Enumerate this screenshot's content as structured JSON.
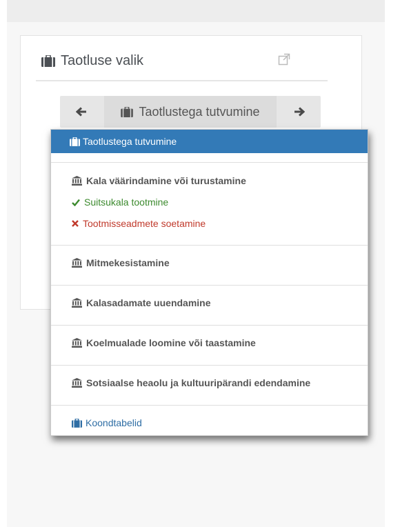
{
  "panel": {
    "title": "Taotluse valik",
    "title_icon": "briefcase-icon",
    "external_icon": "external-link-icon"
  },
  "navigator": {
    "prev_icon": "arrow-left-icon",
    "next_icon": "arrow-right-icon",
    "current_label": "Taotlustega tutvumine",
    "current_icon": "briefcase-icon"
  },
  "dropdown": {
    "active_item": {
      "label": "Taotlustega tutvumine",
      "icon": "briefcase-icon"
    },
    "groups": [
      {
        "label": "Kala väärindamine või turustamine",
        "icon": "institution-icon",
        "subitems": [
          {
            "label": "Suitsukala tootmine",
            "status": "ok",
            "icon": "check-icon"
          },
          {
            "label": "Tootmisseadmete soetamine",
            "status": "error",
            "icon": "times-icon"
          }
        ]
      },
      {
        "label": "Mitmekesistamine",
        "icon": "institution-icon"
      },
      {
        "label": "Kalasadamate uuendamine",
        "icon": "institution-icon"
      },
      {
        "label": "Koelmualade loomine või taastamine",
        "icon": "institution-icon"
      },
      {
        "label": "Sotsiaalse heaolu ja kultuuripärandi edendamine",
        "icon": "institution-icon"
      }
    ],
    "footer_item": {
      "label": "Koondtabelid",
      "icon": "briefcase-icon"
    },
    "colors": {
      "active_bg": "#337ab7",
      "ok": "#3c8a2e",
      "error": "#c0392b",
      "link": "#2e6da4"
    }
  }
}
